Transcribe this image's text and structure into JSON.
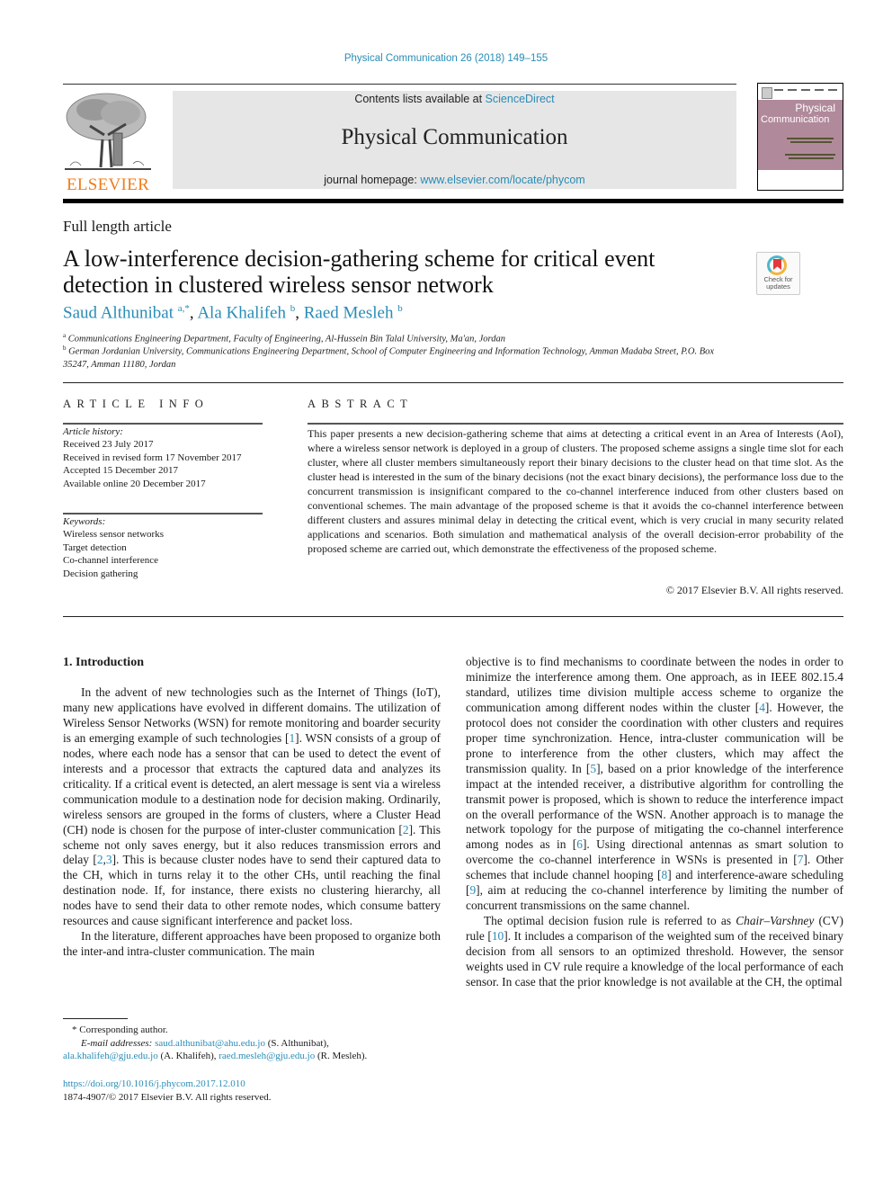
{
  "header": {
    "journal_reference": "Physical Communication 26 (2018) 149–155",
    "publisher_logo_text": "ELSEVIER",
    "contents_prefix": "Contents lists available at ",
    "contents_link": "ScienceDirect",
    "journal_name": "Physical Communication",
    "homepage_prefix": "journal homepage: ",
    "homepage_link": "www.elsevier.com/locate/phycom",
    "cover": {
      "title_line1": "Physical",
      "title_line2": "Communication"
    },
    "colors": {
      "link": "#2a8cb6",
      "elsevier_orange": "#f07c1a",
      "banner_bg": "#e6e6e6"
    }
  },
  "article": {
    "type": "Full length article",
    "title": "A low-interference decision-gathering scheme for critical event detection in clustered wireless sensor network",
    "check_updates": {
      "line1": "Check for",
      "line2": "updates"
    },
    "authors": [
      {
        "name": "Saud Althunibat",
        "sup": "a,*"
      },
      {
        "name": "Ala Khalifeh",
        "sup": "b"
      },
      {
        "name": "Raed Mesleh",
        "sup": "b"
      }
    ],
    "affiliations": [
      {
        "sup": "a",
        "text": "Communications Engineering Department, Faculty of Engineering, Al-Hussein Bin Talal University, Ma'an, Jordan"
      },
      {
        "sup": "b",
        "text": "German Jordanian University, Communications Engineering Department, School of Computer Engineering and Information Technology, Amman Madaba Street, P.O. Box 35247, Amman 11180, Jordan"
      }
    ]
  },
  "article_info": {
    "heading": "ARTICLE INFO",
    "history_label": "Article history:",
    "history": [
      "Received 23 July 2017",
      "Received in revised form 17 November 2017",
      "Accepted 15 December 2017",
      "Available online 20 December 2017"
    ],
    "keywords_label": "Keywords:",
    "keywords": [
      "Wireless sensor networks",
      "Target detection",
      "Co-channel interference",
      "Decision gathering"
    ]
  },
  "abstract": {
    "heading": "ABSTRACT",
    "text": "This paper presents a new decision-gathering scheme that aims at detecting a critical event in an Area of Interests (AoI), where a wireless sensor network is deployed in a group of clusters. The proposed scheme assigns a single time slot for each cluster, where all cluster members simultaneously report their binary decisions to the cluster head on that time slot. As the cluster head is interested in the sum of the binary decisions (not the exact binary decisions), the performance loss due to the concurrent transmission is insignificant compared to the co-channel interference induced from other clusters based on conventional schemes. The main advantage of the proposed scheme is that it avoids the co-channel interference between different clusters and assures minimal delay in detecting the critical event, which is very crucial in many security related applications and scenarios. Both simulation and mathematical analysis of the overall decision-error probability of the proposed scheme are carried out, which demonstrate the effectiveness of the proposed scheme.",
    "copyright": "© 2017 Elsevier B.V. All rights reserved."
  },
  "body": {
    "section_title": "1. Introduction",
    "left_paragraphs": [
      {
        "segments": [
          {
            "t": "In the advent of new technologies such as the Internet of Things (IoT), many new applications have evolved in different domains. The utilization of Wireless Sensor Networks (WSN) for remote monitoring and boarder security is an emerging example of such technologies ["
          },
          {
            "ref": "1"
          },
          {
            "t": "]. WSN consists of a group of nodes, where each node has a sensor that can be used to detect the event of interests and a processor that extracts the captured data and analyzes its criticality. If a critical event is detected, an alert message is sent via a wireless communication module to a destination node for decision making. Ordinarily, wireless sensors are grouped in the forms of clusters, where a Cluster Head (CH) node is chosen for the purpose of inter-cluster communication ["
          },
          {
            "ref": "2"
          },
          {
            "t": "]. This scheme not only saves energy, but it also reduces transmission errors and delay ["
          },
          {
            "ref": "2"
          },
          {
            "t": ","
          },
          {
            "ref": "3"
          },
          {
            "t": "]. This is because cluster nodes have to send their captured data to the CH, which in turns relay it to the other CHs, until reaching the final destination node. If, for instance, there exists no clustering hierarchy, all nodes have to send their data to other remote nodes, which consume battery resources and cause significant interference and packet loss."
          }
        ]
      },
      {
        "segments": [
          {
            "t": "In the literature, different approaches have been proposed to organize both the inter-and intra-cluster communication. The main"
          }
        ]
      }
    ],
    "right_paragraphs": [
      {
        "noindent": true,
        "segments": [
          {
            "t": "objective is to find mechanisms to coordinate between the nodes in order to minimize the interference among them. One approach, as in IEEE 802.15.4 standard, utilizes time division multiple access scheme to organize the communication among different nodes within the cluster ["
          },
          {
            "ref": "4"
          },
          {
            "t": "]. However, the protocol does not consider the coordination with other clusters and requires proper time synchronization. Hence, intra-cluster communication will be prone to interference from the other clusters, which may affect the transmission quality. In ["
          },
          {
            "ref": "5"
          },
          {
            "t": "], based on a prior knowledge of the interference impact at the intended receiver, a distributive algorithm for controlling the transmit power is proposed, which is shown to reduce the interference impact on the overall performance of the WSN. Another approach is to manage the network topology for the purpose of mitigating the co-channel interference among nodes as in ["
          },
          {
            "ref": "6"
          },
          {
            "t": "]. Using directional antennas as smart solution to overcome the co-channel interference in WSNs is presented in ["
          },
          {
            "ref": "7"
          },
          {
            "t": "]. Other schemes that include channel hooping ["
          },
          {
            "ref": "8"
          },
          {
            "t": "] and interference-aware scheduling ["
          },
          {
            "ref": "9"
          },
          {
            "t": "], aim at reducing the co-channel interference by limiting the number of concurrent transmissions on the same channel."
          }
        ]
      },
      {
        "segments": [
          {
            "t": "The optimal decision fusion rule is referred to as "
          },
          {
            "i": "Chair–Varshney"
          },
          {
            "t": " (CV) rule ["
          },
          {
            "ref": "10"
          },
          {
            "t": "]. It includes a comparison of the weighted sum of the received binary decision from all sensors to an optimized threshold. However, the sensor weights used in CV rule require a knowledge of the local performance of each sensor. In case that the prior knowledge is not available at the CH, the optimal"
          }
        ]
      }
    ]
  },
  "footnotes": {
    "star": "*",
    "corresponding": "Corresponding author.",
    "email_label": "E-mail addresses:",
    "emails": [
      {
        "email": "saud.althunibat@ahu.edu.jo",
        "name": "(S. Althunibat),"
      },
      {
        "email": "ala.khalifeh@gju.edu.jo",
        "name": "(A. Khalifeh),"
      },
      {
        "email": "raed.mesleh@gju.edu.jo",
        "name": "(R. Mesleh)."
      }
    ],
    "doi": "https://doi.org/10.1016/j.phycom.2017.12.010",
    "issn_line": "1874-4907/© 2017 Elsevier B.V. All rights reserved."
  }
}
